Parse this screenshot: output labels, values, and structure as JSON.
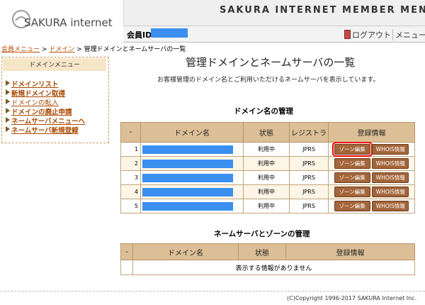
{
  "header": {
    "logo_text": "SAKURA internet",
    "menu_title": "SAKURA INTERNET MEMBER MENU",
    "member_label": "会員ID:",
    "member_id": "",
    "logout_label": "ログアウト",
    "menu_link": "メニュー"
  },
  "breadcrumb": {
    "items": [
      "会員メニュー",
      "ドメイン",
      "管理ドメインとネームサーバの一覧"
    ],
    "separator": " > "
  },
  "sidebar": {
    "title": "ドメインメニュー",
    "items": [
      {
        "label": "ドメインリスト"
      },
      {
        "label": "新規ドメイン取得"
      },
      {
        "label": "ドメインの転入"
      },
      {
        "label": "ドメインの廃止申請"
      },
      {
        "label": "ネームサーバメニューへ"
      },
      {
        "label": "ネームサーバ新規登録"
      }
    ]
  },
  "main": {
    "title": "管理ドメインとネームサーバの一覧",
    "description": "お客様管理のドメイン名とご利用いただけるネームサーバを表示しています。"
  },
  "domain_section": {
    "title": "ドメイン名の管理",
    "columns": [
      "-",
      "ドメイン名",
      "状態",
      "レジストラ",
      "登録情報"
    ],
    "zone_button_label": "ゾーン編集",
    "whois_button_label": "WHOIS情報",
    "rows": [
      {
        "num": "1",
        "domain": "",
        "status": "利用中",
        "registrar": "JPRS"
      },
      {
        "num": "2",
        "domain": "",
        "status": "利用中",
        "registrar": "JPRS"
      },
      {
        "num": "3",
        "domain": "",
        "status": "利用中",
        "registrar": "JPRS"
      },
      {
        "num": "4",
        "domain": "",
        "status": "利用中",
        "registrar": "JPRS"
      },
      {
        "num": "5",
        "domain": "",
        "status": "利用中",
        "registrar": "JPRS"
      }
    ]
  },
  "ns_section": {
    "title": "ネームサーバとゾーンの管理",
    "columns": [
      "-",
      "ドメイン名",
      "状態",
      "登録情報"
    ],
    "empty_message": "表示する情報がありません"
  },
  "footer": {
    "copyright": "(C)Copyright 1996-2017 SAKURA Internet Inc."
  },
  "colors": {
    "accent_link": "#a94800",
    "table_header": "#dcbf96",
    "redacted": "#3a8ff0",
    "highlight": "#ff0000"
  }
}
